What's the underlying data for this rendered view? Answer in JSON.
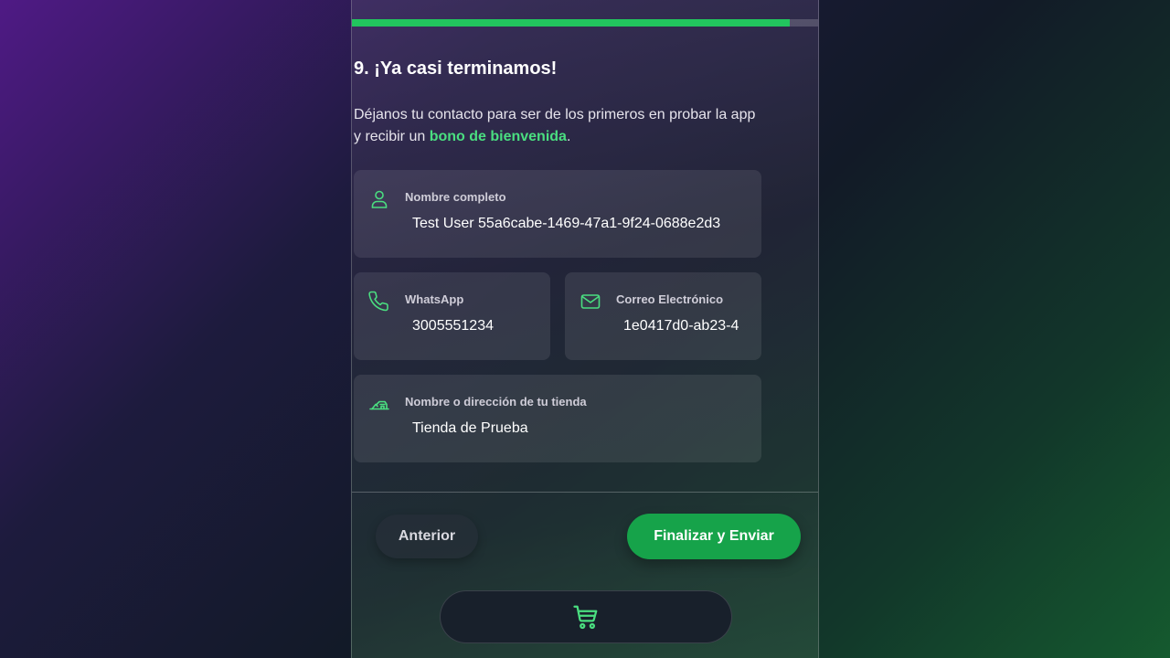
{
  "progress": {
    "fraction": 0.94
  },
  "step": {
    "title": "9. ¡Ya casi terminamos!",
    "intro_before": "Déjanos tu contacto para ser de los primeros en probar la app y recibir un ",
    "intro_highlight": "bono de bienvenida",
    "intro_after": "."
  },
  "form": {
    "name": {
      "label": "Nombre completo",
      "value": "Test User 55a6cabe-1469-47a1-9f24-0688e2d3",
      "icon": "user-icon"
    },
    "whatsapp": {
      "label": "WhatsApp",
      "value": "3005551234",
      "icon": "phone-icon"
    },
    "email": {
      "label": "Correo Electrónico",
      "value": "1e0417d0-ab23-4",
      "icon": "mail-icon"
    },
    "store": {
      "label": "Nombre o dirección de tu tienda",
      "value": "Tienda de Prueba",
      "icon": "store-icon"
    }
  },
  "nav": {
    "prev_label": "Anterior",
    "submit_label": "Finalizar y Enviar"
  },
  "cart": {
    "icon": "cart-icon"
  },
  "colors": {
    "accent": "#22c55e",
    "button": "#16a34a",
    "highlight_text": "#4ade80"
  }
}
